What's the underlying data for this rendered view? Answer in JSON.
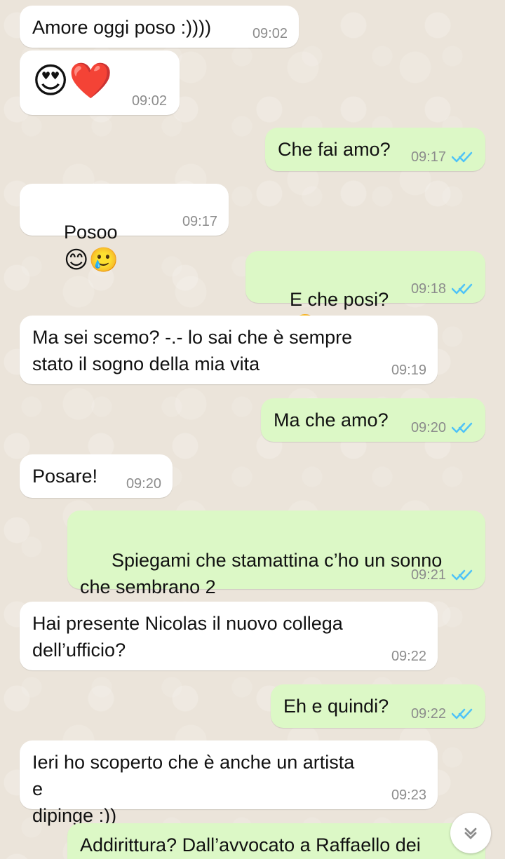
{
  "messages": [
    {
      "type": "incoming",
      "text": "Amore oggi poso :))))",
      "time": "09:02"
    },
    {
      "type": "incoming",
      "emojis": "😍❤️",
      "time": "09:02"
    },
    {
      "type": "outgoing",
      "text": "Che fai amo?",
      "time": "09:17"
    },
    {
      "type": "incoming",
      "text": "Posoo",
      "emojis": "😊🥲",
      "time": "09:17"
    },
    {
      "type": "outgoing",
      "text": "E che posi?",
      "emojis": "🤣",
      "time": "09:18"
    },
    {
      "type": "incoming",
      "text": "Ma sei scemo? -.- lo sai che è sempre\nstato il sogno della mia vita",
      "time": "09:19"
    },
    {
      "type": "outgoing",
      "text": "Ma che amo?",
      "time": "09:20"
    },
    {
      "type": "incoming",
      "text": "Posare!",
      "time": "09:20"
    },
    {
      "type": "outgoing",
      "text": "Spiegami che stamattina c’ho un sonno\nche sembrano 2",
      "emojis": "🥱",
      "time": "09:21"
    },
    {
      "type": "incoming",
      "text": "Hai presente Nicolas il nuovo collega\ndell’ufficio?",
      "time": "09:22"
    },
    {
      "type": "outgoing",
      "text": "Eh e quindi?",
      "time": "09:22"
    },
    {
      "type": "incoming",
      "text": "Ieri ho scoperto che è anche un artista e\ndipinge :))",
      "time": "09:23"
    },
    {
      "type": "outgoing",
      "text": "Addirittura? Dall’avvocato a Raffaello dei"
    }
  ],
  "colors": {
    "incoming_bg": "#ffffff",
    "outgoing_bg": "#dcf8c6",
    "meta": "#8c8c8c",
    "check": "#4fc3f7"
  },
  "icons": {
    "read_receipt": "double-check-icon",
    "scroll_down": "chevron-double-down-icon"
  }
}
